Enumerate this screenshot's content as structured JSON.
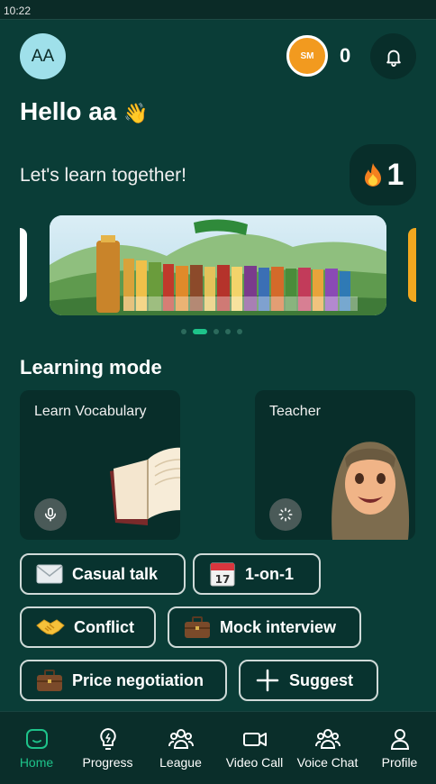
{
  "status_bar": {
    "time": "10:22"
  },
  "header": {
    "avatar_initials": "AA",
    "coin_badge": "SM",
    "coin_count": "0",
    "bell_icon": "bell-icon"
  },
  "greeting": {
    "title": "Hello aa",
    "wave_emoji": "👋",
    "subtitle": "Let's learn together!"
  },
  "streak": {
    "icon": "fire-icon",
    "count": "1"
  },
  "carousel": {
    "slide_count": 5,
    "active_index": 1
  },
  "learning_mode": {
    "title": "Learning mode",
    "cards": [
      {
        "label": "Learn Vocabulary",
        "icon": "microphone-icon"
      },
      {
        "label": "Teacher",
        "icon": "spinner-icon"
      }
    ]
  },
  "topics": [
    {
      "label": "Casual talk",
      "icon": "envelope-icon"
    },
    {
      "label": "1-on-1",
      "icon": "calendar-icon"
    },
    {
      "label": "Conflict",
      "icon": "handshake-icon"
    },
    {
      "label": "Mock interview",
      "icon": "briefcase-icon"
    },
    {
      "label": "Price negotiation",
      "icon": "briefcase-icon"
    },
    {
      "label": "Suggest",
      "icon": "plus-icon"
    }
  ],
  "nav": [
    {
      "label": "Home",
      "icon": "home-icon",
      "active": true
    },
    {
      "label": "Progress",
      "icon": "lightbulb-icon"
    },
    {
      "label": "League",
      "icon": "users-icon"
    },
    {
      "label": "Video Call",
      "icon": "video-icon"
    },
    {
      "label": "Voice Chat",
      "icon": "users-icon"
    },
    {
      "label": "Profile",
      "icon": "person-icon"
    }
  ],
  "colors": {
    "background": "#0a3d37",
    "accent": "#1ec38a",
    "coin": "#f29a1f",
    "card": "#082e2a"
  }
}
